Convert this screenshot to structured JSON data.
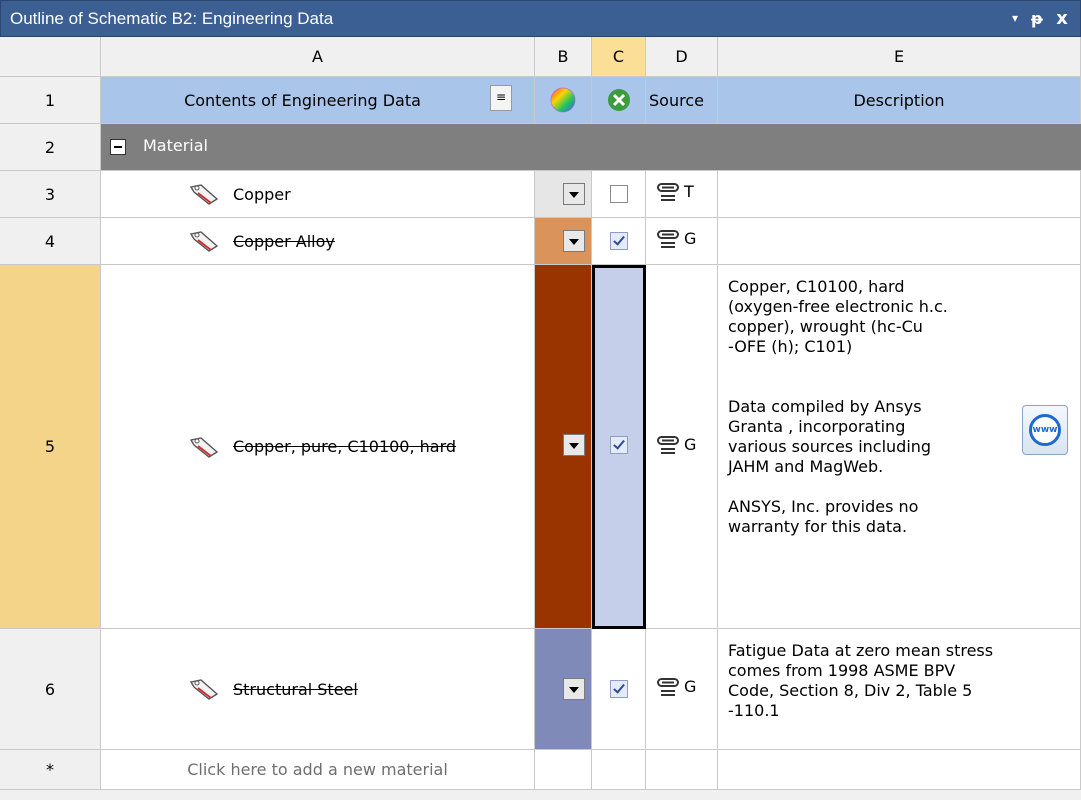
{
  "window": {
    "title": "Outline of Schematic B2: Engineering Data",
    "dropdown_glyph": "▾",
    "pin_glyph": "ᵽ",
    "close_glyph": "x"
  },
  "columns": {
    "A": "A",
    "B": "B",
    "C": "C",
    "D": "D",
    "E": "E"
  },
  "header_row": {
    "row_number": "1",
    "contents_label": "Contents of Engineering Data",
    "source_label": "Source",
    "description_label": "Description",
    "sort_icon": "sort-icon",
    "color_icon": "color-wheel-icon",
    "suppress_icon": "suppress-icon"
  },
  "category_row": {
    "row_number": "2",
    "toggle": "−",
    "label": "Material"
  },
  "materials": [
    {
      "row_number": "3",
      "name": "Copper",
      "strikethrough": false,
      "color": "#e6e6e6",
      "checked": false,
      "source_trunc": "T",
      "description": ""
    },
    {
      "row_number": "4",
      "name": "Copper Alloy",
      "strikethrough": true,
      "color": "#d9935b",
      "checked": true,
      "source_trunc": "G",
      "description": ""
    },
    {
      "row_number": "5",
      "name": "Copper, pure, C10100, hard",
      "strikethrough": true,
      "color": "#993300",
      "checked": true,
      "source_trunc": "G",
      "description": "Copper, C10100, hard\n(oxygen-free electronic h.c.\ncopper), wrought (hc-Cu\n-OFE (h); C101)\n\n\nData compiled by Ansys\nGranta , incorporating\nvarious sources including\nJAHM and MagWeb.\n\nANSYS, Inc. provides no\nwarranty for this data.",
      "www_label": "www"
    },
    {
      "row_number": "6",
      "name": "Structural Steel",
      "strikethrough": true,
      "color": "#7f8ab8",
      "checked": true,
      "source_trunc": "G",
      "description": "Fatigue Data at zero mean stress\ncomes from 1998 ASME BPV\nCode, Section 8, Div 2, Table 5\n-110.1"
    }
  ],
  "new_row": {
    "row_number": "*",
    "placeholder": "Click here to add a new material"
  },
  "colors": {
    "title_bar": "#3b5e93",
    "header_blue": "#a9c6ea",
    "category_gray": "#7f7f7f",
    "selected_row": "#f4d488",
    "selected_cell": "#c5cfea"
  }
}
